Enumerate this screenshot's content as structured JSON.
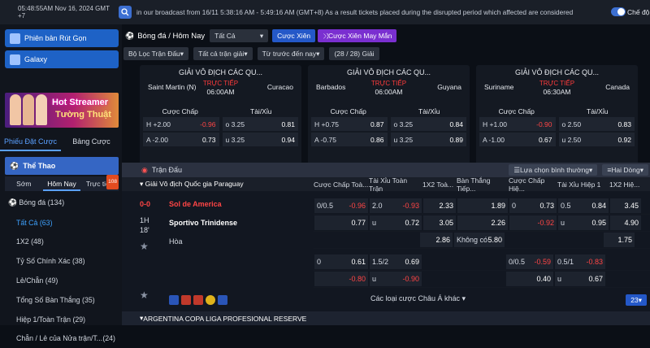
{
  "topbar": {
    "clock": "05:48:55AM Nov 16, 2024 GMT +7",
    "marquee": "in our broadcast from 16/11 5:38:16 AM - 5:49:16 AM (GMT+8) As a result tickets placed during the disrupted period which affected are considered",
    "toggle_label": "Chế độ n"
  },
  "sidebar": {
    "btn_withdraw": "Phiên bản Rút Gọn",
    "btn_galaxy": "Galaxy",
    "promo_line1": "Hot Streamer",
    "promo_line2": "Tường Thuật",
    "tab_bet": "Phiếu Đặt Cược",
    "tab_board": "Bảng Cược",
    "sports": "Thể Thao",
    "htab_early": "Sớm",
    "htab_today": "Hôm Nay",
    "htab_live": "Trực tiếp",
    "live_badge": "108",
    "items": [
      {
        "label": "Bóng đá",
        "count": "(134)"
      },
      {
        "label": "Tất Cả",
        "count": "(63)"
      },
      {
        "label": "1X2",
        "count": "(48)"
      },
      {
        "label": "Tỷ Số Chính Xác",
        "count": "(38)"
      },
      {
        "label": "Lẻ/Chẵn",
        "count": "(49)"
      },
      {
        "label": "Tổng Số Bàn Thắng",
        "count": "(35)"
      },
      {
        "label": "Hiệp 1/Toàn Trận",
        "count": "(29)"
      },
      {
        "label": "Chẵn / Lẻ của Nửa trận/T...",
        "count": "(24)"
      }
    ]
  },
  "toolbar": {
    "title": "Bóng đá / Hôm Nay",
    "sel_all": "Tất Cả",
    "parlay": "Cược Xiên",
    "lucky": "Cược Xiên May Mắn",
    "filter": "Bộ Lọc Trận Đấu",
    "all_leagues": "Tất cả trận giải",
    "time": "Từ trước đến nay",
    "count": "(28 / 28) Giải"
  },
  "cards": [
    {
      "title": "GIẢI VÔ ĐỊCH CÁC QU...",
      "home": "Saint Martin (N)",
      "away": "Curacao",
      "status": "TRỰC TIẾP",
      "time": "06:00AM",
      "h_label": "Cược Chấp",
      "t_label": "Tài/Xỉu",
      "r1": [
        "H +2.00",
        "-0.96",
        "o 3.25",
        "0.81"
      ],
      "r2": [
        "A -2.00",
        "0.73",
        "u 3.25",
        "0.94"
      ]
    },
    {
      "title": "GIẢI VÔ ĐỊCH CÁC QU...",
      "home": "Barbados",
      "away": "Guyana",
      "status": "TRỰC TIẾP",
      "time": "06:00AM",
      "h_label": "Cược Chấp",
      "t_label": "Tài/Xỉu",
      "r1": [
        "H +0.75",
        "0.87",
        "o 3.25",
        "0.84"
      ],
      "r2": [
        "A -0.75",
        "0.86",
        "u 3.25",
        "0.89"
      ]
    },
    {
      "title": "GIẢI VÔ ĐỊCH CÁC QU...",
      "home": "Suriname",
      "away": "Canada",
      "status": "TRỰC TIẾP",
      "time": "06:30AM",
      "h_label": "Cược Chấp",
      "t_label": "Tài/Xỉu",
      "r1": [
        "H +1.00",
        "-0.90",
        "o 2.50",
        "0.83"
      ],
      "r2": [
        "A -1.00",
        "0.67",
        "u 2.50",
        "0.92"
      ]
    }
  ],
  "table": {
    "bar_title": "Trận Đấu",
    "sort": "Lựa chọn bình thường",
    "lines": "Hai Dòng",
    "league": "Giải Vô địch Quốc gia Paraguay",
    "cols": [
      "Cược Chấp Toà...",
      "Tài Xỉu Toàn Trận",
      "1X2 Toà...",
      "Bàn Thắng Tiếp...",
      "Cược Chấp Hiệ...",
      "Tài Xỉu Hiệp 1",
      "1X2 Hiệ..."
    ],
    "score": "0-0",
    "half": "1H",
    "minute": "18'",
    "home": "Sol de America",
    "away": "Sportivo Trinidense",
    "draw": "Hòa",
    "r1": [
      "0/0.5",
      "-0.96",
      "2.0",
      "-0.93",
      "2.33",
      "",
      "1.89",
      "0",
      "0.73",
      "0.5",
      "0.84",
      "3.45"
    ],
    "r2": [
      "",
      "0.77",
      "u",
      "0.72",
      "3.05",
      "",
      "2.26",
      "",
      "-0.92",
      "u",
      "0.95",
      "4.90"
    ],
    "r3": [
      "",
      "",
      "",
      "",
      "2.86",
      "Không có",
      "5.80",
      "",
      "",
      "",
      "",
      "1.75"
    ],
    "r4": [
      "0",
      "0.61",
      "1.5/2",
      "0.69",
      "",
      "",
      "",
      "0/0.5",
      "-0.59",
      "0.5/1",
      "-0.83",
      ""
    ],
    "r5": [
      "",
      "-0.80",
      "u",
      "-0.90",
      "",
      "",
      "",
      "",
      "0.40",
      "u",
      "0.67",
      ""
    ],
    "more": "Các loại cược Châu Á khác",
    "pager": "23",
    "next_league": "ARGENTINA COPA LIGA PROFESIONAL RESERVE"
  }
}
